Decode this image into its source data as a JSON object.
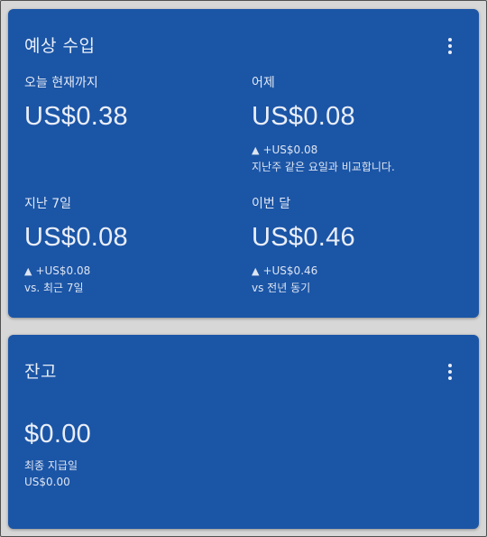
{
  "earnings": {
    "title": "예상 수입",
    "today": {
      "label": "오늘 현재까지",
      "value": "US$0.38"
    },
    "yesterday": {
      "label": "어제",
      "value": "US$0.08",
      "change": "+US$0.08",
      "note": "지난주 같은 요일과 비교합니다."
    },
    "last7": {
      "label": "지난 7일",
      "value": "US$0.08",
      "change": "+US$0.08",
      "note": "vs. 최근 7일"
    },
    "this_month": {
      "label": "이번 달",
      "value": "US$0.46",
      "change": "+US$0.46",
      "note": "vs 전년 동기"
    }
  },
  "balance": {
    "title": "잔고",
    "value": "$0.00",
    "last_payment_label": "최종 지급일",
    "last_payment_value": "US$0.00"
  },
  "icons": {
    "more": "more-vert-icon",
    "up": "triangle-up-icon"
  },
  "colors": {
    "card_background": "#1b55a6",
    "page_background": "#d7d7d7",
    "text": "#e8eef8"
  }
}
